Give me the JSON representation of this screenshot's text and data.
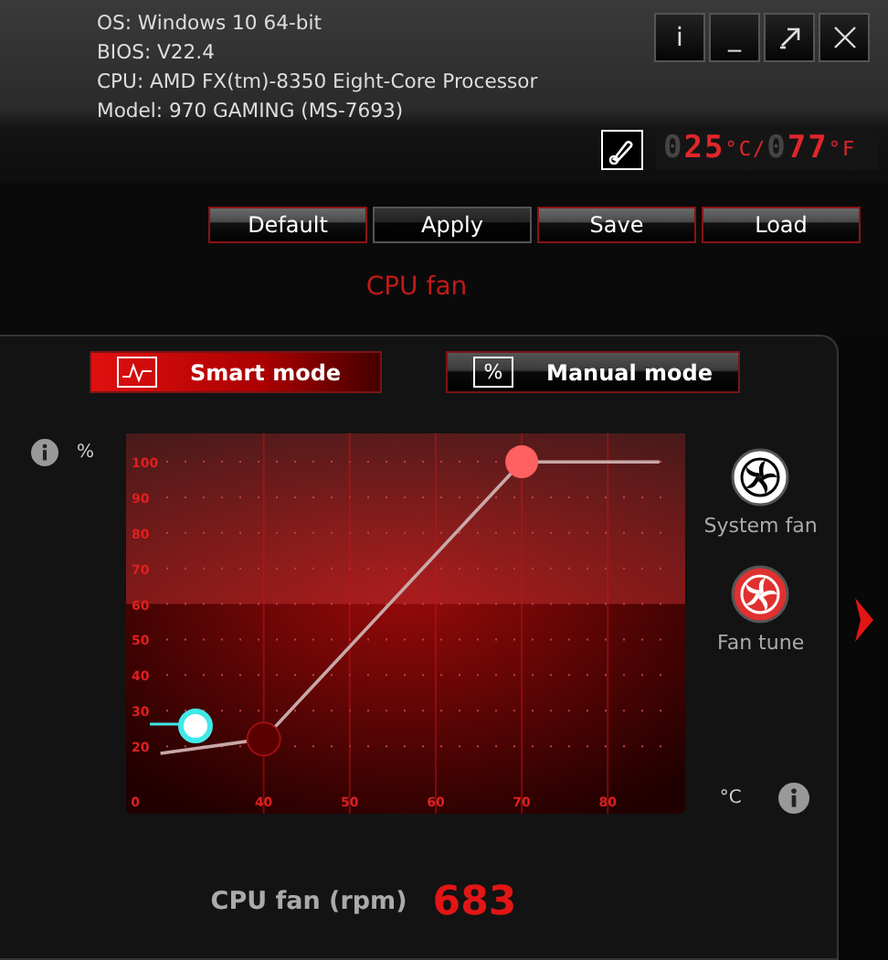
{
  "system_info": [
    "OS: Windows 10 64-bit",
    "BIOS: V22.4",
    "CPU: AMD FX(tm)-8350 Eight-Core Processor",
    "Model: 970 GAMING (MS-7693)"
  ],
  "window_buttons": [
    {
      "kind": "info",
      "label": "i"
    },
    {
      "kind": "minimize",
      "label": "_"
    },
    {
      "kind": "mini"
    },
    {
      "kind": "close"
    }
  ],
  "temperature": {
    "celsius": {
      "lead": "0",
      "value": "25",
      "unit": "°C"
    },
    "separator": "/",
    "fahrenheit": {
      "lead": "0",
      "value": "77",
      "unit": "°F"
    }
  },
  "toolbar": [
    {
      "label": "Default",
      "active": false
    },
    {
      "label": "Apply",
      "active": true
    },
    {
      "label": "Save",
      "active": false
    },
    {
      "label": "Load",
      "active": false
    }
  ],
  "title": "CPU fan",
  "modes": [
    {
      "label": "Smart mode",
      "kind": "smart",
      "selected": true
    },
    {
      "label": "Manual mode",
      "kind": "manual",
      "icon_text": "%",
      "selected": false
    }
  ],
  "y_unit": "%",
  "x_unit": "°C",
  "origin_label": "0",
  "chart_data": {
    "type": "line",
    "x": [
      28,
      40,
      70,
      86
    ],
    "series": [
      {
        "color": "#c8a8a8",
        "values": [
          18,
          22,
          100,
          100
        ]
      }
    ],
    "xlim": [
      24,
      89
    ],
    "ylim": [
      1,
      108
    ],
    "xticks": [
      40,
      50,
      60,
      70,
      80
    ],
    "yticks": [
      20,
      30,
      40,
      50,
      60,
      70,
      80,
      90,
      100
    ],
    "grid": true,
    "bands": [
      {
        "axis": "y",
        "from": 60,
        "to": 108
      }
    ]
  },
  "fan_sources": [
    {
      "label": "System fan",
      "selected": false
    },
    {
      "label": "Fan tune",
      "selected": true
    }
  ],
  "readout": {
    "label": "CPU fan (rpm)",
    "value": "683"
  }
}
